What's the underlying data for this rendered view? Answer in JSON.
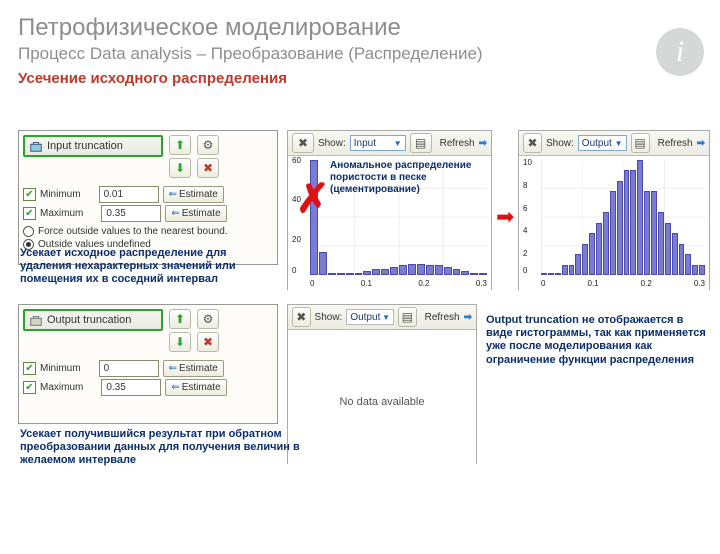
{
  "heading": {
    "title": "Петрофизическое моделирование",
    "subtitle": "Процесс Data analysis – Преобразование (Распределение)",
    "section": "Усечение исходного распределения"
  },
  "panel_input": {
    "header": "Input truncation",
    "min_label": "Minimum",
    "min_value": "0.01",
    "max_label": "Maximum",
    "max_value": "0.35",
    "estimate": "Estimate",
    "radio1": "Force outside values to the nearest bound.",
    "radio2": "Outside values undefined"
  },
  "panel_output": {
    "header": "Output truncation",
    "min_label": "Minimum",
    "min_value": "0",
    "max_label": "Maximum",
    "max_value": "0.35",
    "estimate": "Estimate"
  },
  "chart": {
    "show": "Show:",
    "input_sel": "Input",
    "output_sel": "Output",
    "refresh": "Refresh",
    "no_data": "No data available",
    "x_ticks": [
      "0",
      "0.1",
      "0.2",
      "0.3"
    ],
    "y_left": [
      "60",
      "40",
      "20",
      "0"
    ],
    "y_right": [
      "10",
      "8",
      "6",
      "4",
      "2",
      "0"
    ]
  },
  "chart_data": [
    {
      "type": "bar",
      "title": "Input histogram",
      "xlabel": "",
      "ylabel": "",
      "x_ticks": [
        0,
        0.1,
        0.2,
        0.3
      ],
      "ylim": [
        0,
        60
      ],
      "values": [
        60,
        12,
        1,
        1,
        0,
        1,
        2,
        3,
        3,
        4,
        5,
        6,
        6,
        5,
        5,
        4,
        3,
        2,
        1,
        1
      ]
    },
    {
      "type": "bar",
      "title": "Output histogram",
      "xlabel": "",
      "ylabel": "",
      "x_ticks": [
        0,
        0.1,
        0.2,
        0.3
      ],
      "ylim": [
        0,
        11
      ],
      "values": [
        0,
        0,
        0,
        1,
        1,
        2,
        3,
        4,
        5,
        6,
        8,
        9,
        10,
        10,
        11,
        8,
        8,
        6,
        5,
        4,
        3,
        2,
        1,
        1
      ]
    }
  ],
  "annotations": {
    "input_desc": "Усекает исходное распределение для удаления нехарактерных значений или помещения их в соседний интервал",
    "output_desc": "Усекает получившийся результат при обратном преобразовании данных для получения величин в желаемом интервале",
    "anomalous": "Аномальное распределение пористости в песке (цементирование)",
    "output_note": "Output truncation не отображается в виде гистограммы, так как применяется уже после моделирования как ограничение функции распределения"
  }
}
